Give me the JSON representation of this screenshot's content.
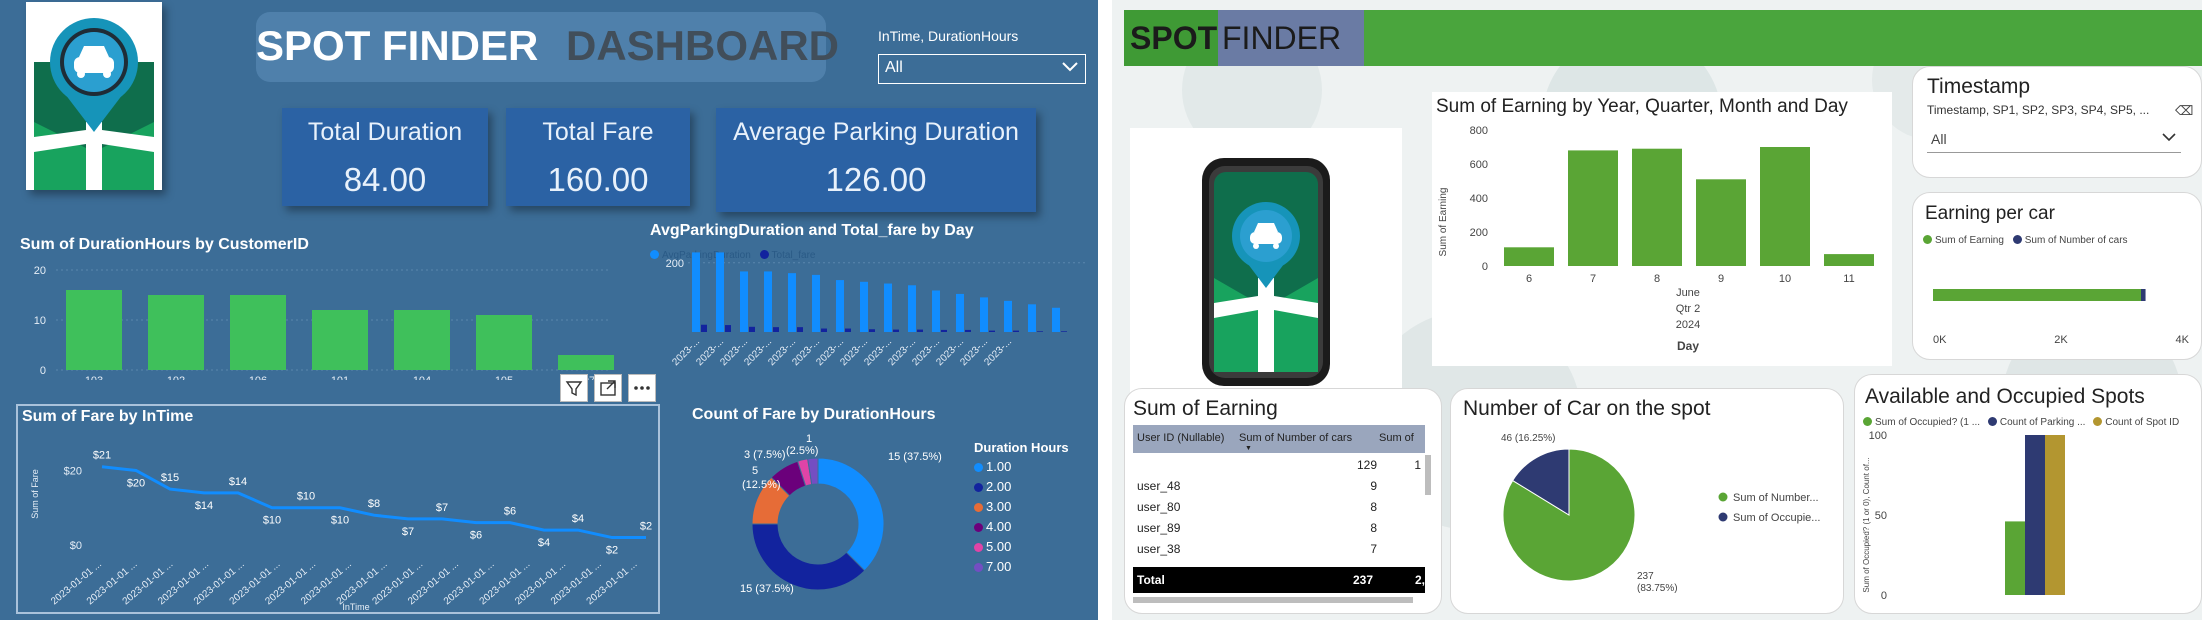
{
  "left": {
    "title_part1": "SPOT FINDER",
    "title_part2": "DASHBOARD",
    "filter": {
      "label": "InTime, DurationHours",
      "value": "All"
    },
    "kpis": [
      {
        "label": "Total Duration",
        "value": "84.00"
      },
      {
        "label": "Total Fare",
        "value": "160.00"
      },
      {
        "label": "Average Parking Duration",
        "value": "126.00"
      }
    ],
    "duration_chart": {
      "title": "Sum of DurationHours by CustomerID",
      "yticks": [
        "20",
        "10",
        "0"
      ]
    },
    "avg_chart": {
      "title": "AvgParkingDuration and Total_fare by Day",
      "legend": [
        "AvgParkingDuration",
        "Total_fare"
      ],
      "ytick": "200",
      "x_label": "2023-..."
    },
    "fare_chart": {
      "title": "Sum of Fare by InTime",
      "ylabel": "Sum of Fare",
      "xlabel": "InTime",
      "yticks": [
        "$20",
        "$0"
      ],
      "x_label": "2023-01-01 ..."
    },
    "donut": {
      "title": "Count of Fare by DurationHours",
      "legend_title": "Duration Hours",
      "labels": [
        "15 (37.5%)",
        "15 (37.5%)",
        "5",
        "(12.5%)",
        "3 (7.5%)",
        "1",
        "(2.5%)"
      ]
    },
    "toolbar_icons": [
      "filter-icon",
      "focus-mode-icon",
      "more-options-icon"
    ]
  },
  "right": {
    "title_part1": "SPOT",
    "title_part2": "FINDER",
    "earning_chart": {
      "title": "Sum of Earning by Year, Quarter, Month and Day",
      "ylabel": "Sum of Earning",
      "yticks": [
        "800",
        "600",
        "400",
        "200",
        "0"
      ],
      "x_sub": [
        "June",
        "Qtr 2",
        "2024"
      ],
      "xlabel": "Day"
    },
    "timestamp_slicer": {
      "title": "Timestamp",
      "subtitle": "Timestamp, SP1, SP2, SP3, SP4, SP5, ...",
      "value": "All"
    },
    "earning_per_car": {
      "title": "Earning per car",
      "legend": [
        "Sum of Earning",
        "Sum of Number of cars"
      ],
      "xticks": [
        "0K",
        "2K",
        "4K"
      ]
    },
    "table": {
      "title": "Sum of Earning",
      "columns": [
        "User ID (Nullable)",
        "Sum of Number of cars",
        "Sum of"
      ],
      "rows": [
        {
          "user": "",
          "cars": "129",
          "extra": "1"
        },
        {
          "user": "user_48",
          "cars": "9",
          "extra": ""
        },
        {
          "user": "user_80",
          "cars": "8",
          "extra": ""
        },
        {
          "user": "user_89",
          "cars": "8",
          "extra": ""
        },
        {
          "user": "user_38",
          "cars": "7",
          "extra": ""
        }
      ],
      "total_label": "Total",
      "total_value": "237",
      "total_extra": "2,"
    },
    "pie": {
      "title": "Number of Car on the spot",
      "label_small": "46 (16.25%)",
      "label_big_1": "237",
      "label_big_2": "(83.75%)",
      "legend": [
        "Sum of Number...",
        "Sum of Occupie..."
      ]
    },
    "spots_chart": {
      "title": "Available and Occupied Spots",
      "legend": [
        "Sum of Occupied? (1 ...",
        "Count of Parking ...",
        "Count of Spot ID"
      ],
      "ylabel": "Sum of Occupied? (1 or 0), Count of...",
      "yticks": [
        "100",
        "50",
        "0"
      ]
    }
  },
  "chart_data": [
    {
      "type": "bar",
      "title": "Sum of DurationHours by CustomerID",
      "categories": [
        "103",
        "102",
        "106",
        "101",
        "104",
        "105",
        "107"
      ],
      "values": [
        16,
        15,
        15,
        12,
        12,
        11,
        3
      ],
      "ylim": [
        0,
        20
      ]
    },
    {
      "type": "bar",
      "title": "AvgParkingDuration and Total_fare by Day",
      "series": [
        {
          "name": "AvgParkingDuration",
          "values": [
            230,
            230,
            175,
            175,
            170,
            165,
            150,
            145,
            140,
            135,
            120,
            110,
            100,
            90,
            80,
            70
          ]
        },
        {
          "name": "Total_fare",
          "values": [
            21,
            20,
            15,
            14,
            14,
            10,
            10,
            8,
            7,
            7,
            6,
            6,
            4,
            4,
            2,
            2
          ]
        }
      ],
      "ylim": [
        0,
        260
      ]
    },
    {
      "type": "line",
      "title": "Sum of Fare by InTime",
      "x": [
        "2023-01-01 ...",
        "2023-01-01 ...",
        "2023-01-01 ...",
        "2023-01-01 ...",
        "2023-01-01 ...",
        "2023-01-01 ...",
        "2023-01-01 ...",
        "2023-01-01 ...",
        "2023-01-01 ...",
        "2023-01-01 ...",
        "2023-01-01 ...",
        "2023-01-01 ...",
        "2023-01-01 ...",
        "2023-01-01 ...",
        "2023-01-01 ...",
        "2023-01-01 ..."
      ],
      "values": [
        21,
        20,
        15,
        14,
        14,
        10,
        10,
        10,
        8,
        7,
        7,
        6,
        6,
        4,
        4,
        2,
        2
      ],
      "point_labels": [
        "$21",
        "$20",
        "$15",
        "$14",
        "$14",
        "$10",
        "$10",
        "$10",
        "$8",
        "$7",
        "$7",
        "$6",
        "$6",
        "$4",
        "$4",
        "$2",
        "$2"
      ],
      "ylim": [
        0,
        22
      ]
    },
    {
      "type": "pie",
      "title": "Count of Fare by DurationHours",
      "categories": [
        "1.00",
        "2.00",
        "3.00",
        "4.00",
        "5.00",
        "7.00"
      ],
      "values": [
        15,
        15,
        5,
        3,
        1,
        1
      ],
      "colors": [
        "#118dff",
        "#12239e",
        "#e66c37",
        "#6b007b",
        "#e044a7",
        "#744ec2"
      ]
    },
    {
      "type": "bar",
      "title": "Sum of Earning by Year, Quarter, Month and Day",
      "categories": [
        "6",
        "7",
        "8",
        "9",
        "10",
        "11"
      ],
      "values": [
        110,
        680,
        690,
        510,
        700,
        70
      ],
      "ylim": [
        0,
        800
      ],
      "xlabel": "Day",
      "ylabel": "Sum of Earning"
    },
    {
      "type": "bar",
      "title": "Earning per car",
      "series": [
        {
          "name": "Sum of Earning",
          "values": [
            3250
          ]
        },
        {
          "name": "Sum of Number of cars",
          "values": [
            237
          ]
        }
      ],
      "xlim": [
        0,
        4000
      ]
    },
    {
      "type": "pie",
      "title": "Number of Car on the spot",
      "categories": [
        "Sum of Number...",
        "Sum of Occupie..."
      ],
      "values": [
        237,
        46
      ],
      "colors": [
        "#5aa535",
        "#2e3a72"
      ]
    },
    {
      "type": "bar",
      "title": "Available and Occupied Spots",
      "series": [
        {
          "name": "Sum of Occupied? (1 ...",
          "values": [
            46
          ]
        },
        {
          "name": "Count of Parking ...",
          "values": [
            100
          ]
        },
        {
          "name": "Count of Spot ID",
          "values": [
            100
          ]
        }
      ],
      "ylim": [
        0,
        100
      ]
    }
  ],
  "colors": {
    "left_bg": "#3c6d97",
    "kpi_bg": "#2b62a4",
    "bar_green": "#3fc05b",
    "bar_blue": "#118dff",
    "right_green": "#5aa535",
    "right_navy": "#2e3a72",
    "right_gold": "#b39630"
  }
}
